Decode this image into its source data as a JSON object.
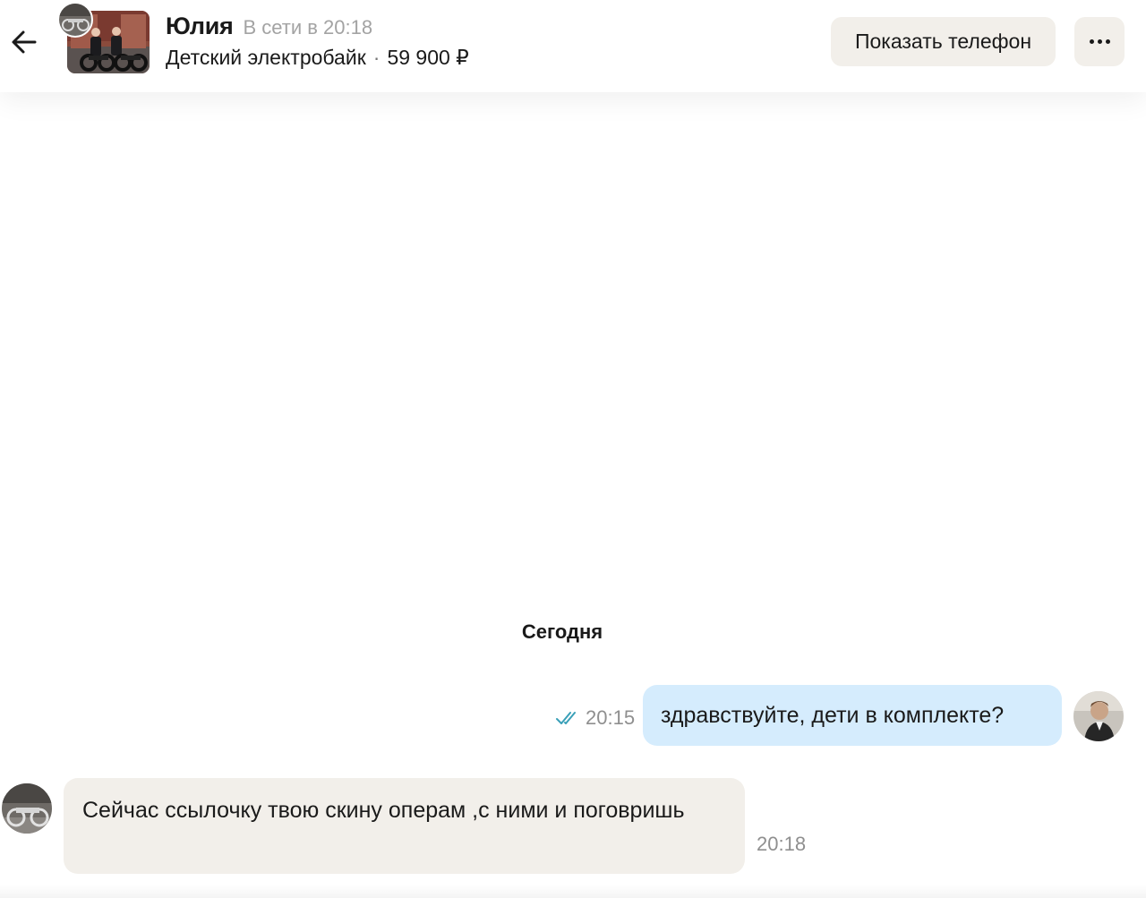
{
  "header": {
    "back_icon": "arrow-left-icon",
    "seller_name": "Юлия",
    "online_status": "В сети в 20:18",
    "item_title": "Детский электробайк",
    "separator": "·",
    "item_price": "59 900 ₽",
    "show_phone_label": "Показать телефон",
    "more_icon": "more-horizontal-icon"
  },
  "chat": {
    "date_separator": "Сегодня",
    "messages": [
      {
        "direction": "outgoing",
        "text": "здравствуйте, дети в комплекте?",
        "time": "20:15",
        "status_icon": "double-check-icon"
      },
      {
        "direction": "incoming",
        "text": "Сейчас ссылочку твою скину операм ,с ними и поговришь",
        "time": "20:18"
      }
    ]
  },
  "colors": {
    "outgoing_bubble": "#d5ecfd",
    "incoming_bubble": "#f2efea",
    "button_bg": "#f2efea",
    "read_check": "#3aa0b8",
    "muted_text": "#8f8f8f"
  }
}
